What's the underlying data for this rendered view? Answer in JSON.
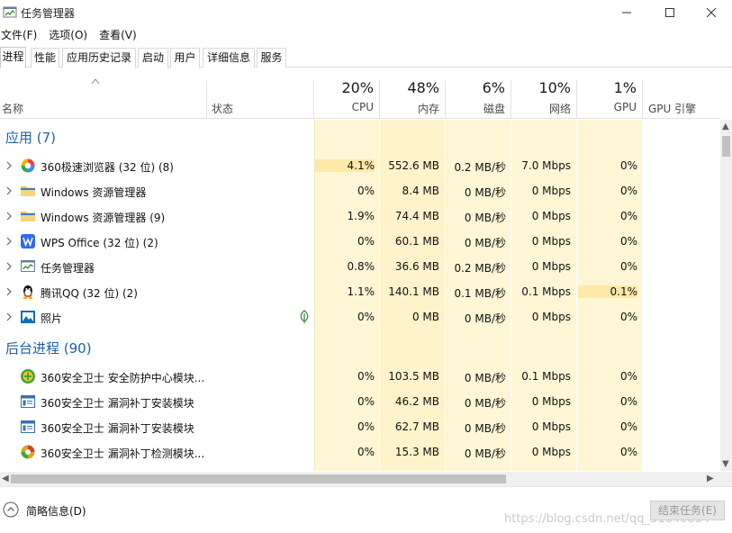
{
  "window": {
    "title": "任务管理器",
    "minimize_icon": "minimize-icon",
    "maximize_icon": "maximize-icon",
    "close_icon": "close-icon"
  },
  "menu": [
    "文件(F)",
    "选项(O)",
    "查看(V)"
  ],
  "tabs": [
    {
      "label": "进程",
      "active": true
    },
    {
      "label": "性能",
      "active": false
    },
    {
      "label": "应用历史记录",
      "active": false
    },
    {
      "label": "启动",
      "active": false
    },
    {
      "label": "用户",
      "active": false
    },
    {
      "label": "详细信息",
      "active": false
    },
    {
      "label": "服务",
      "active": false
    }
  ],
  "header": {
    "name_label": "名称",
    "status_label": "状态",
    "cpu_pct": "20%",
    "cpu_label": "CPU",
    "mem_pct": "48%",
    "mem_label": "内存",
    "disk_pct": "6%",
    "disk_label": "磁盘",
    "net_pct": "10%",
    "net_label": "网络",
    "gpu_pct": "1%",
    "gpu_label": "GPU",
    "gpu_engine_label": "GPU 引擎"
  },
  "groups": {
    "apps": "应用 (7)",
    "background": "后台进程 (90)"
  },
  "apps": [
    {
      "name": "360极速浏览器 (32 位) (8)",
      "cpu": "4.1%",
      "mem": "552.6 MB",
      "disk": "0.2 MB/秒",
      "net": "7.0 Mbps",
      "gpu": "0%",
      "icon": "360-browser-icon"
    },
    {
      "name": "Windows 资源管理器",
      "cpu": "0%",
      "mem": "8.4 MB",
      "disk": "0 MB/秒",
      "net": "0 Mbps",
      "gpu": "0%",
      "icon": "folder-icon"
    },
    {
      "name": "Windows 资源管理器 (9)",
      "cpu": "1.9%",
      "mem": "74.4 MB",
      "disk": "0 MB/秒",
      "net": "0 Mbps",
      "gpu": "0%",
      "icon": "folder-icon"
    },
    {
      "name": "WPS Office (32 位) (2)",
      "cpu": "0%",
      "mem": "60.1 MB",
      "disk": "0 MB/秒",
      "net": "0 Mbps",
      "gpu": "0%",
      "icon": "wps-icon"
    },
    {
      "name": "任务管理器",
      "cpu": "0.8%",
      "mem": "36.6 MB",
      "disk": "0.2 MB/秒",
      "net": "0 Mbps",
      "gpu": "0%",
      "icon": "task-manager-icon"
    },
    {
      "name": "腾讯QQ (32 位) (2)",
      "cpu": "1.1%",
      "mem": "140.1 MB",
      "disk": "0.1 MB/秒",
      "net": "0.1 Mbps",
      "gpu": "0.1%",
      "icon": "qq-icon"
    },
    {
      "name": "照片",
      "cpu": "0%",
      "mem": "0 MB",
      "disk": "0 MB/秒",
      "net": "0 Mbps",
      "gpu": "0%",
      "icon": "photos-icon"
    }
  ],
  "background": [
    {
      "name": "360安全卫士 安全防护中心模块...",
      "cpu": "0%",
      "mem": "103.5 MB",
      "disk": "0 MB/秒",
      "net": "0.1 Mbps",
      "gpu": "0%",
      "icon": "360-safe-icon"
    },
    {
      "name": "360安全卫士 漏洞补丁安装模块",
      "cpu": "0%",
      "mem": "46.2 MB",
      "disk": "0 MB/秒",
      "net": "0 Mbps",
      "gpu": "0%",
      "icon": "patch-installer-icon"
    },
    {
      "name": "360安全卫士 漏洞补丁安装模块",
      "cpu": "0%",
      "mem": "62.7 MB",
      "disk": "0 MB/秒",
      "net": "0 Mbps",
      "gpu": "0%",
      "icon": "patch-installer-icon"
    },
    {
      "name": "360安全卫士 漏洞补丁检测模块...",
      "cpu": "0%",
      "mem": "15.3 MB",
      "disk": "0 MB/秒",
      "net": "0 Mbps",
      "gpu": "0%",
      "icon": "patch-detector-icon"
    }
  ],
  "footer": {
    "brief_label": "简略信息(D)",
    "end_task_label": "结束任务(E)",
    "watermark": "https://blog.csdn.net/qq_31840854"
  },
  "colors": {
    "heat_light": "#fff9e6",
    "heat_mid": "#fff3cc",
    "heat_strong": "#ffe9a8",
    "group_title": "#1e5fa8"
  }
}
